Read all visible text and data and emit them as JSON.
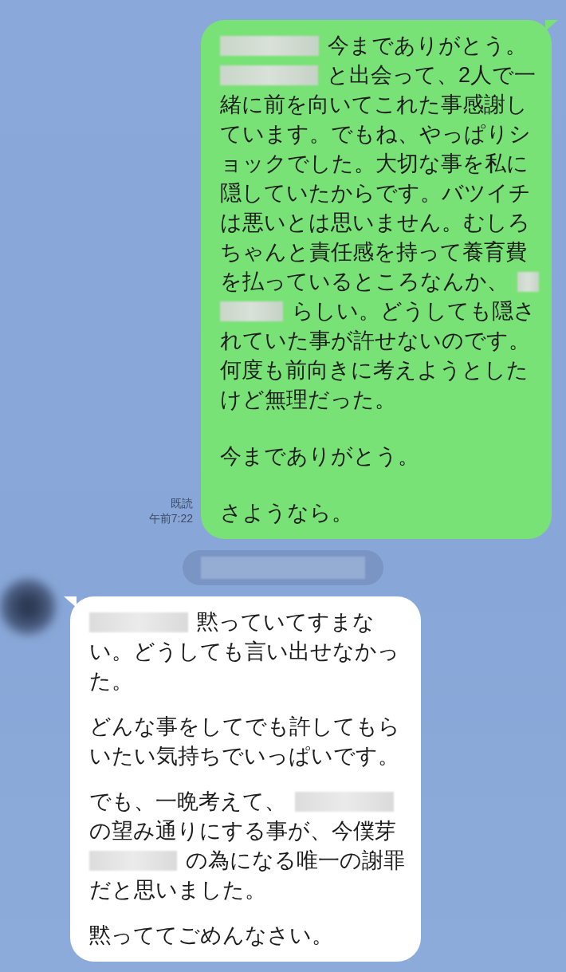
{
  "messages": [
    {
      "kind": "sent",
      "read": "既読",
      "time": "午前7:22",
      "paragraphs": [
        [
          [
            {
              "kind": "redacted"
            },
            {
              "kind": "text",
              "text": "今までありがとう。"
            }
          ],
          [
            {
              "kind": "redacted"
            },
            {
              "kind": "text",
              "text": "と出会って、2人で一"
            }
          ],
          [
            {
              "kind": "text",
              "text": "緒に前を向いてこれた事感謝し"
            }
          ],
          [
            {
              "kind": "text",
              "text": "ています。でもね、やっぱりシ"
            }
          ],
          [
            {
              "kind": "text",
              "text": "ョックでした。大切な事を私に"
            }
          ],
          [
            {
              "kind": "text",
              "text": "隠していたからです。バツイチ"
            }
          ],
          [
            {
              "kind": "text",
              "text": "は悪いとは思いません。むしろ"
            }
          ],
          [
            {
              "kind": "text",
              "text": "ちゃんと責任感を持って養育費"
            }
          ],
          [
            {
              "kind": "text",
              "text": "を払っているところなんか、"
            },
            {
              "kind": "redacted"
            }
          ],
          [
            {
              "kind": "redacted"
            },
            {
              "kind": "text",
              "text": "らしい。どうしても隠さ"
            }
          ],
          [
            {
              "kind": "text",
              "text": "れていた事が許せないのです。"
            }
          ],
          [
            {
              "kind": "text",
              "text": "何度も前向きに考えようとした"
            }
          ],
          [
            {
              "kind": "text",
              "text": "けど無理だった。"
            }
          ]
        ],
        [
          [
            {
              "kind": "text",
              "text": "今までありがとう。"
            }
          ]
        ],
        [
          [
            {
              "kind": "text",
              "text": "さようなら。"
            }
          ]
        ]
      ]
    },
    {
      "kind": "date"
    },
    {
      "kind": "received",
      "paragraphs": [
        [
          [
            {
              "kind": "redacted"
            },
            {
              "kind": "text",
              "text": "黙っていてすまな"
            }
          ],
          [
            {
              "kind": "text",
              "text": "い。どうしても言い出せなかっ"
            }
          ],
          [
            {
              "kind": "text",
              "text": "た。"
            }
          ]
        ],
        [
          [
            {
              "kind": "text",
              "text": "どんな事をしてでも許してもら"
            }
          ],
          [
            {
              "kind": "text",
              "text": "いたい気持ちでいっぱいです。"
            }
          ]
        ],
        [
          [
            {
              "kind": "text",
              "text": "でも、一晩考えて、"
            },
            {
              "kind": "redacted"
            }
          ],
          [
            {
              "kind": "text",
              "text": "の望み通りにする事が、今僕芽"
            }
          ],
          [
            {
              "kind": "redacted"
            },
            {
              "kind": "text",
              "text": "の為になる唯一の謝罪"
            }
          ],
          [
            {
              "kind": "text",
              "text": "だと思いました。"
            }
          ]
        ],
        [
          [
            {
              "kind": "text",
              "text": "黙っててごめんなさい。"
            }
          ]
        ]
      ]
    }
  ]
}
